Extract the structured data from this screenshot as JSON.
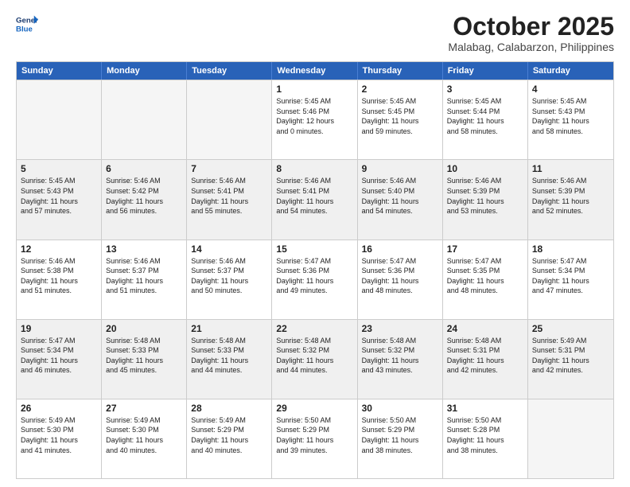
{
  "header": {
    "logo_general": "General",
    "logo_blue": "Blue",
    "month": "October 2025",
    "location": "Malabag, Calabarzon, Philippines"
  },
  "days_of_week": [
    "Sunday",
    "Monday",
    "Tuesday",
    "Wednesday",
    "Thursday",
    "Friday",
    "Saturday"
  ],
  "rows": [
    [
      {
        "num": "",
        "text": "",
        "empty": true
      },
      {
        "num": "",
        "text": "",
        "empty": true
      },
      {
        "num": "",
        "text": "",
        "empty": true
      },
      {
        "num": "1",
        "text": "Sunrise: 5:45 AM\nSunset: 5:46 PM\nDaylight: 12 hours\nand 0 minutes."
      },
      {
        "num": "2",
        "text": "Sunrise: 5:45 AM\nSunset: 5:45 PM\nDaylight: 11 hours\nand 59 minutes."
      },
      {
        "num": "3",
        "text": "Sunrise: 5:45 AM\nSunset: 5:44 PM\nDaylight: 11 hours\nand 58 minutes."
      },
      {
        "num": "4",
        "text": "Sunrise: 5:45 AM\nSunset: 5:43 PM\nDaylight: 11 hours\nand 58 minutes."
      }
    ],
    [
      {
        "num": "5",
        "text": "Sunrise: 5:45 AM\nSunset: 5:43 PM\nDaylight: 11 hours\nand 57 minutes."
      },
      {
        "num": "6",
        "text": "Sunrise: 5:46 AM\nSunset: 5:42 PM\nDaylight: 11 hours\nand 56 minutes."
      },
      {
        "num": "7",
        "text": "Sunrise: 5:46 AM\nSunset: 5:41 PM\nDaylight: 11 hours\nand 55 minutes."
      },
      {
        "num": "8",
        "text": "Sunrise: 5:46 AM\nSunset: 5:41 PM\nDaylight: 11 hours\nand 54 minutes."
      },
      {
        "num": "9",
        "text": "Sunrise: 5:46 AM\nSunset: 5:40 PM\nDaylight: 11 hours\nand 54 minutes."
      },
      {
        "num": "10",
        "text": "Sunrise: 5:46 AM\nSunset: 5:39 PM\nDaylight: 11 hours\nand 53 minutes."
      },
      {
        "num": "11",
        "text": "Sunrise: 5:46 AM\nSunset: 5:39 PM\nDaylight: 11 hours\nand 52 minutes."
      }
    ],
    [
      {
        "num": "12",
        "text": "Sunrise: 5:46 AM\nSunset: 5:38 PM\nDaylight: 11 hours\nand 51 minutes."
      },
      {
        "num": "13",
        "text": "Sunrise: 5:46 AM\nSunset: 5:37 PM\nDaylight: 11 hours\nand 51 minutes."
      },
      {
        "num": "14",
        "text": "Sunrise: 5:46 AM\nSunset: 5:37 PM\nDaylight: 11 hours\nand 50 minutes."
      },
      {
        "num": "15",
        "text": "Sunrise: 5:47 AM\nSunset: 5:36 PM\nDaylight: 11 hours\nand 49 minutes."
      },
      {
        "num": "16",
        "text": "Sunrise: 5:47 AM\nSunset: 5:36 PM\nDaylight: 11 hours\nand 48 minutes."
      },
      {
        "num": "17",
        "text": "Sunrise: 5:47 AM\nSunset: 5:35 PM\nDaylight: 11 hours\nand 48 minutes."
      },
      {
        "num": "18",
        "text": "Sunrise: 5:47 AM\nSunset: 5:34 PM\nDaylight: 11 hours\nand 47 minutes."
      }
    ],
    [
      {
        "num": "19",
        "text": "Sunrise: 5:47 AM\nSunset: 5:34 PM\nDaylight: 11 hours\nand 46 minutes."
      },
      {
        "num": "20",
        "text": "Sunrise: 5:48 AM\nSunset: 5:33 PM\nDaylight: 11 hours\nand 45 minutes."
      },
      {
        "num": "21",
        "text": "Sunrise: 5:48 AM\nSunset: 5:33 PM\nDaylight: 11 hours\nand 44 minutes."
      },
      {
        "num": "22",
        "text": "Sunrise: 5:48 AM\nSunset: 5:32 PM\nDaylight: 11 hours\nand 44 minutes."
      },
      {
        "num": "23",
        "text": "Sunrise: 5:48 AM\nSunset: 5:32 PM\nDaylight: 11 hours\nand 43 minutes."
      },
      {
        "num": "24",
        "text": "Sunrise: 5:48 AM\nSunset: 5:31 PM\nDaylight: 11 hours\nand 42 minutes."
      },
      {
        "num": "25",
        "text": "Sunrise: 5:49 AM\nSunset: 5:31 PM\nDaylight: 11 hours\nand 42 minutes."
      }
    ],
    [
      {
        "num": "26",
        "text": "Sunrise: 5:49 AM\nSunset: 5:30 PM\nDaylight: 11 hours\nand 41 minutes."
      },
      {
        "num": "27",
        "text": "Sunrise: 5:49 AM\nSunset: 5:30 PM\nDaylight: 11 hours\nand 40 minutes."
      },
      {
        "num": "28",
        "text": "Sunrise: 5:49 AM\nSunset: 5:29 PM\nDaylight: 11 hours\nand 40 minutes."
      },
      {
        "num": "29",
        "text": "Sunrise: 5:50 AM\nSunset: 5:29 PM\nDaylight: 11 hours\nand 39 minutes."
      },
      {
        "num": "30",
        "text": "Sunrise: 5:50 AM\nSunset: 5:29 PM\nDaylight: 11 hours\nand 38 minutes."
      },
      {
        "num": "31",
        "text": "Sunrise: 5:50 AM\nSunset: 5:28 PM\nDaylight: 11 hours\nand 38 minutes."
      },
      {
        "num": "",
        "text": "",
        "empty": true
      }
    ]
  ]
}
